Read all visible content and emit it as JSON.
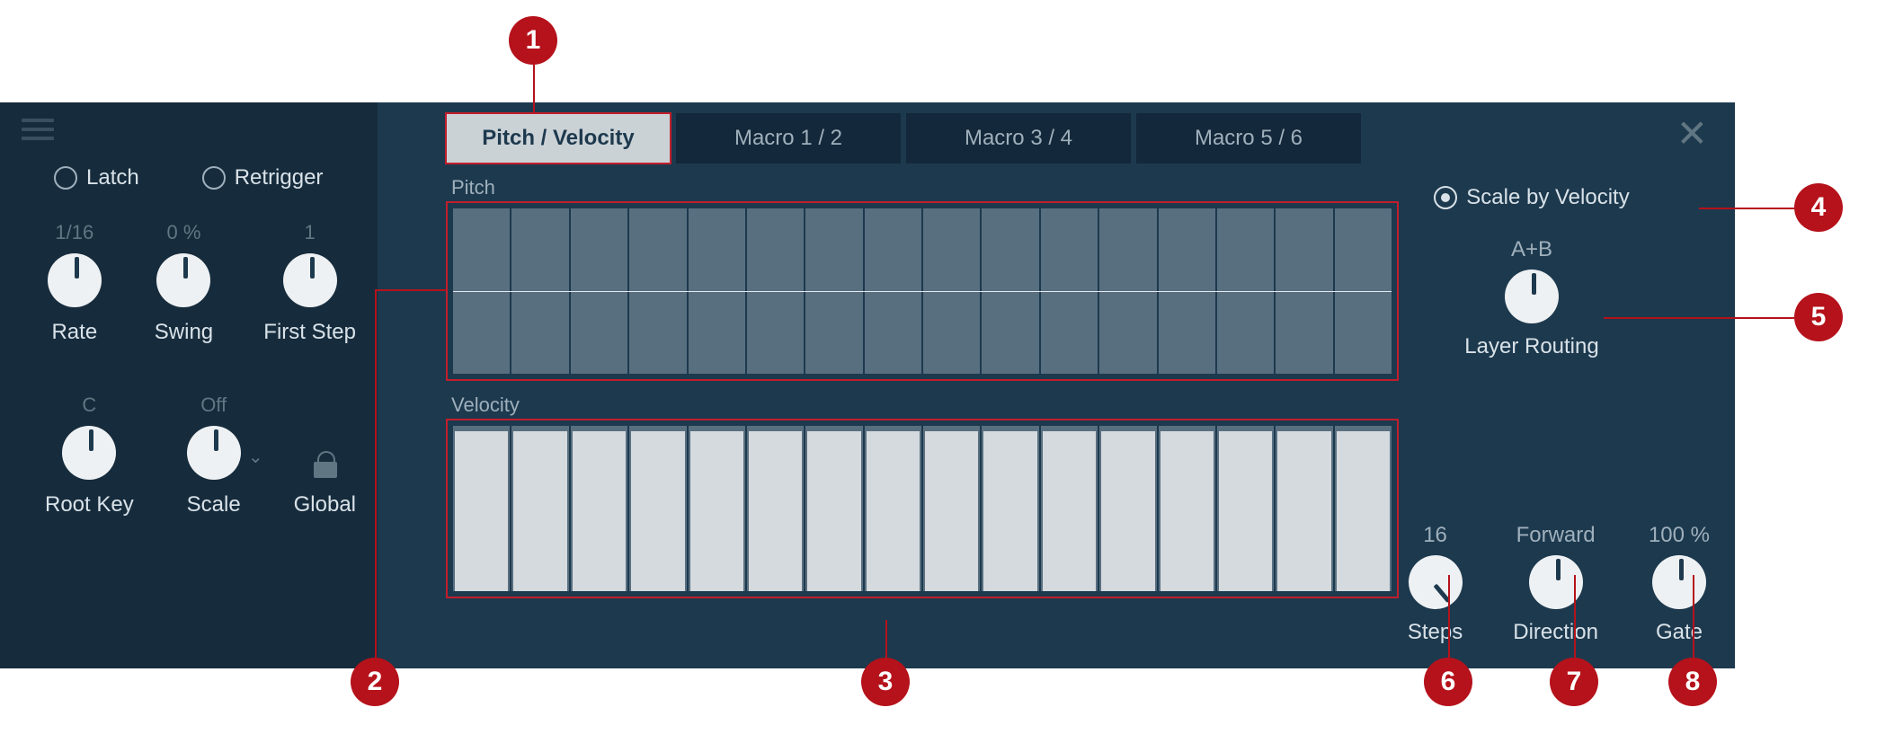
{
  "sidebar": {
    "latch": "Latch",
    "retrigger": "Retrigger",
    "rate_val": "1/16",
    "rate_lbl": "Rate",
    "swing_val": "0 %",
    "swing_lbl": "Swing",
    "first_val": "1",
    "first_lbl": "First Step",
    "root_val": "C",
    "root_lbl": "Root Key",
    "scale_val": "Off",
    "scale_lbl": "Scale",
    "global_lbl": "Global"
  },
  "tabs": [
    "Pitch / Velocity",
    "Macro 1 / 2",
    "Macro 3 / 4",
    "Macro 5 / 6"
  ],
  "pitch_lbl": "Pitch",
  "velocity_lbl": "Velocity",
  "right": {
    "scale_by_vel": "Scale by Velocity",
    "layer_val": "A+B",
    "layer_lbl": "Layer Routing",
    "steps_val": "16",
    "steps_lbl": "Steps",
    "dir_val": "Forward",
    "dir_lbl": "Direction",
    "gate_val": "100 %",
    "gate_lbl": "Gate"
  },
  "markers": [
    "1",
    "2",
    "3",
    "4",
    "5",
    "6",
    "7",
    "8"
  ]
}
